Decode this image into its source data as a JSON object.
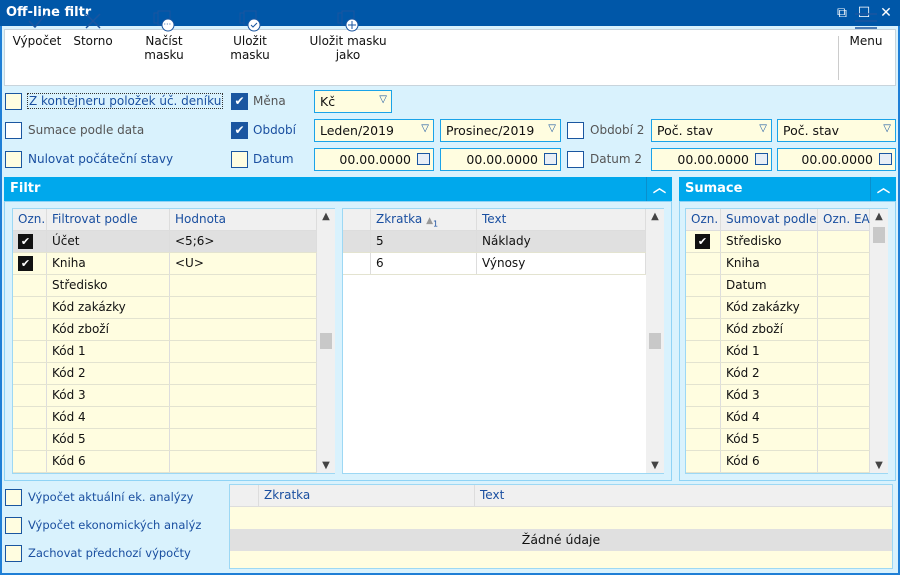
{
  "window": {
    "title": "Off-line filtr"
  },
  "toolbar": {
    "buttons": [
      {
        "label": "Výpočet",
        "icon": "check-icon"
      },
      {
        "label": "Storno",
        "icon": "close-icon"
      },
      {
        "label": "Načíst masku",
        "icon": "load-mask-icon"
      },
      {
        "label": "Uložit masku",
        "icon": "save-mask-icon"
      },
      {
        "label": "Uložit masku jako",
        "icon": "save-mask-as-icon"
      }
    ],
    "menu": "Menu"
  },
  "options": {
    "z_kontejneru": {
      "label": "Z kontejneru položek úč. deníku",
      "checked": false
    },
    "sumace_podle_data": {
      "label": "Sumace podle data",
      "checked": false
    },
    "nulovat": {
      "label": "Nulovat počáteční stavy",
      "checked": false
    },
    "mena": {
      "label": "Měna",
      "checked": true,
      "value": "Kč"
    },
    "obdobi": {
      "label": "Období",
      "checked": true,
      "from": "Leden/2019",
      "to": "Prosinec/2019"
    },
    "datum": {
      "label": "Datum",
      "checked": false,
      "from": "00.00.0000",
      "to": "00.00.0000"
    },
    "obdobi2": {
      "label": "Období 2",
      "checked": false,
      "from": "Poč. stav",
      "to": "Poč. stav"
    },
    "datum2": {
      "label": "Datum 2",
      "checked": false,
      "from": "00.00.0000",
      "to": "00.00.0000"
    }
  },
  "filtr": {
    "title": "Filtr",
    "columns": [
      "Ozn.",
      "Filtrovat podle",
      "Hodnota"
    ],
    "rows": [
      {
        "checked": true,
        "name": "Účet",
        "value": "<5;6>"
      },
      {
        "checked": true,
        "name": "Kniha",
        "value": "<U>"
      },
      {
        "checked": false,
        "name": "Středisko",
        "value": ""
      },
      {
        "checked": false,
        "name": "Kód zakázky",
        "value": ""
      },
      {
        "checked": false,
        "name": "Kód zboží",
        "value": ""
      },
      {
        "checked": false,
        "name": "Kód 1",
        "value": ""
      },
      {
        "checked": false,
        "name": "Kód 2",
        "value": ""
      },
      {
        "checked": false,
        "name": "Kód 3",
        "value": ""
      },
      {
        "checked": false,
        "name": "Kód 4",
        "value": ""
      },
      {
        "checked": false,
        "name": "Kód 5",
        "value": ""
      },
      {
        "checked": false,
        "name": "Kód 6",
        "value": ""
      }
    ],
    "values_columns": [
      "Zkratka",
      "Text"
    ],
    "sort_index": "1",
    "values_rows": [
      {
        "code": "5",
        "text": "Náklady"
      },
      {
        "code": "6",
        "text": "Výnosy"
      }
    ]
  },
  "sumace": {
    "title": "Sumace",
    "columns": [
      "Ozn.",
      "Sumovat podle",
      "Ozn. EA"
    ],
    "rows": [
      {
        "checked": true,
        "name": "Středisko"
      },
      {
        "checked": false,
        "name": "Kniha"
      },
      {
        "checked": false,
        "name": "Datum"
      },
      {
        "checked": false,
        "name": "Kód zakázky"
      },
      {
        "checked": false,
        "name": "Kód zboží"
      },
      {
        "checked": false,
        "name": "Kód 1"
      },
      {
        "checked": false,
        "name": "Kód 2"
      },
      {
        "checked": false,
        "name": "Kód 3"
      },
      {
        "checked": false,
        "name": "Kód 4"
      },
      {
        "checked": false,
        "name": "Kód 5"
      },
      {
        "checked": false,
        "name": "Kód 6"
      }
    ]
  },
  "bottom": {
    "options": [
      {
        "label": "Výpočet aktuální ek. analýzy",
        "checked": false
      },
      {
        "label": "Výpočet ekonomických analýz",
        "checked": false
      },
      {
        "label": "Zachovat předchozí výpočty",
        "checked": false
      }
    ],
    "columns": [
      "Zkratka",
      "Text"
    ],
    "empty": "Žádné údaje"
  }
}
